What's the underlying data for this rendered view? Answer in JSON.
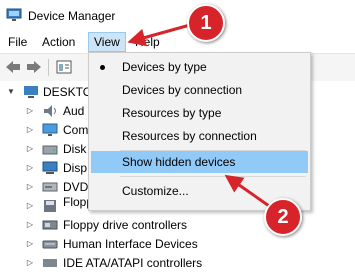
{
  "window": {
    "title": "Device Manager"
  },
  "menubar": {
    "items": [
      {
        "label": "File"
      },
      {
        "label": "Action"
      },
      {
        "label": "View"
      },
      {
        "label": "Help"
      }
    ]
  },
  "toolbar": {
    "buttons": [
      "back-icon",
      "forward-icon",
      "properties-icon",
      "help-icon",
      "computer-icon"
    ]
  },
  "tree": {
    "root_label": "DESKTO",
    "children": [
      {
        "label": "Aud",
        "icon": "speaker-icon"
      },
      {
        "label": "Com",
        "icon": "monitor-icon"
      },
      {
        "label": "Disk",
        "icon": "disk-icon"
      },
      {
        "label": "Disp",
        "icon": "display-icon"
      },
      {
        "label": "DVD",
        "icon": "dvd-icon"
      },
      {
        "label": "Floppy disk drives",
        "icon": "floppy-icon"
      },
      {
        "label": "Floppy drive controllers",
        "icon": "controller-icon"
      },
      {
        "label": "Human Interface Devices",
        "icon": "hid-icon"
      },
      {
        "label": "IDE ATA/ATAPI controllers",
        "icon": "ide-icon"
      }
    ]
  },
  "view_menu": {
    "items": [
      {
        "label": "Devices by type",
        "selected": true
      },
      {
        "label": "Devices by connection"
      },
      {
        "label": "Resources by type"
      },
      {
        "label": "Resources by connection"
      },
      {
        "label": "Show hidden devices",
        "highlighted": true
      },
      {
        "label": "Customize..."
      }
    ]
  },
  "annotations": {
    "step1": "1",
    "step2": "2",
    "color": "#d7242b"
  }
}
